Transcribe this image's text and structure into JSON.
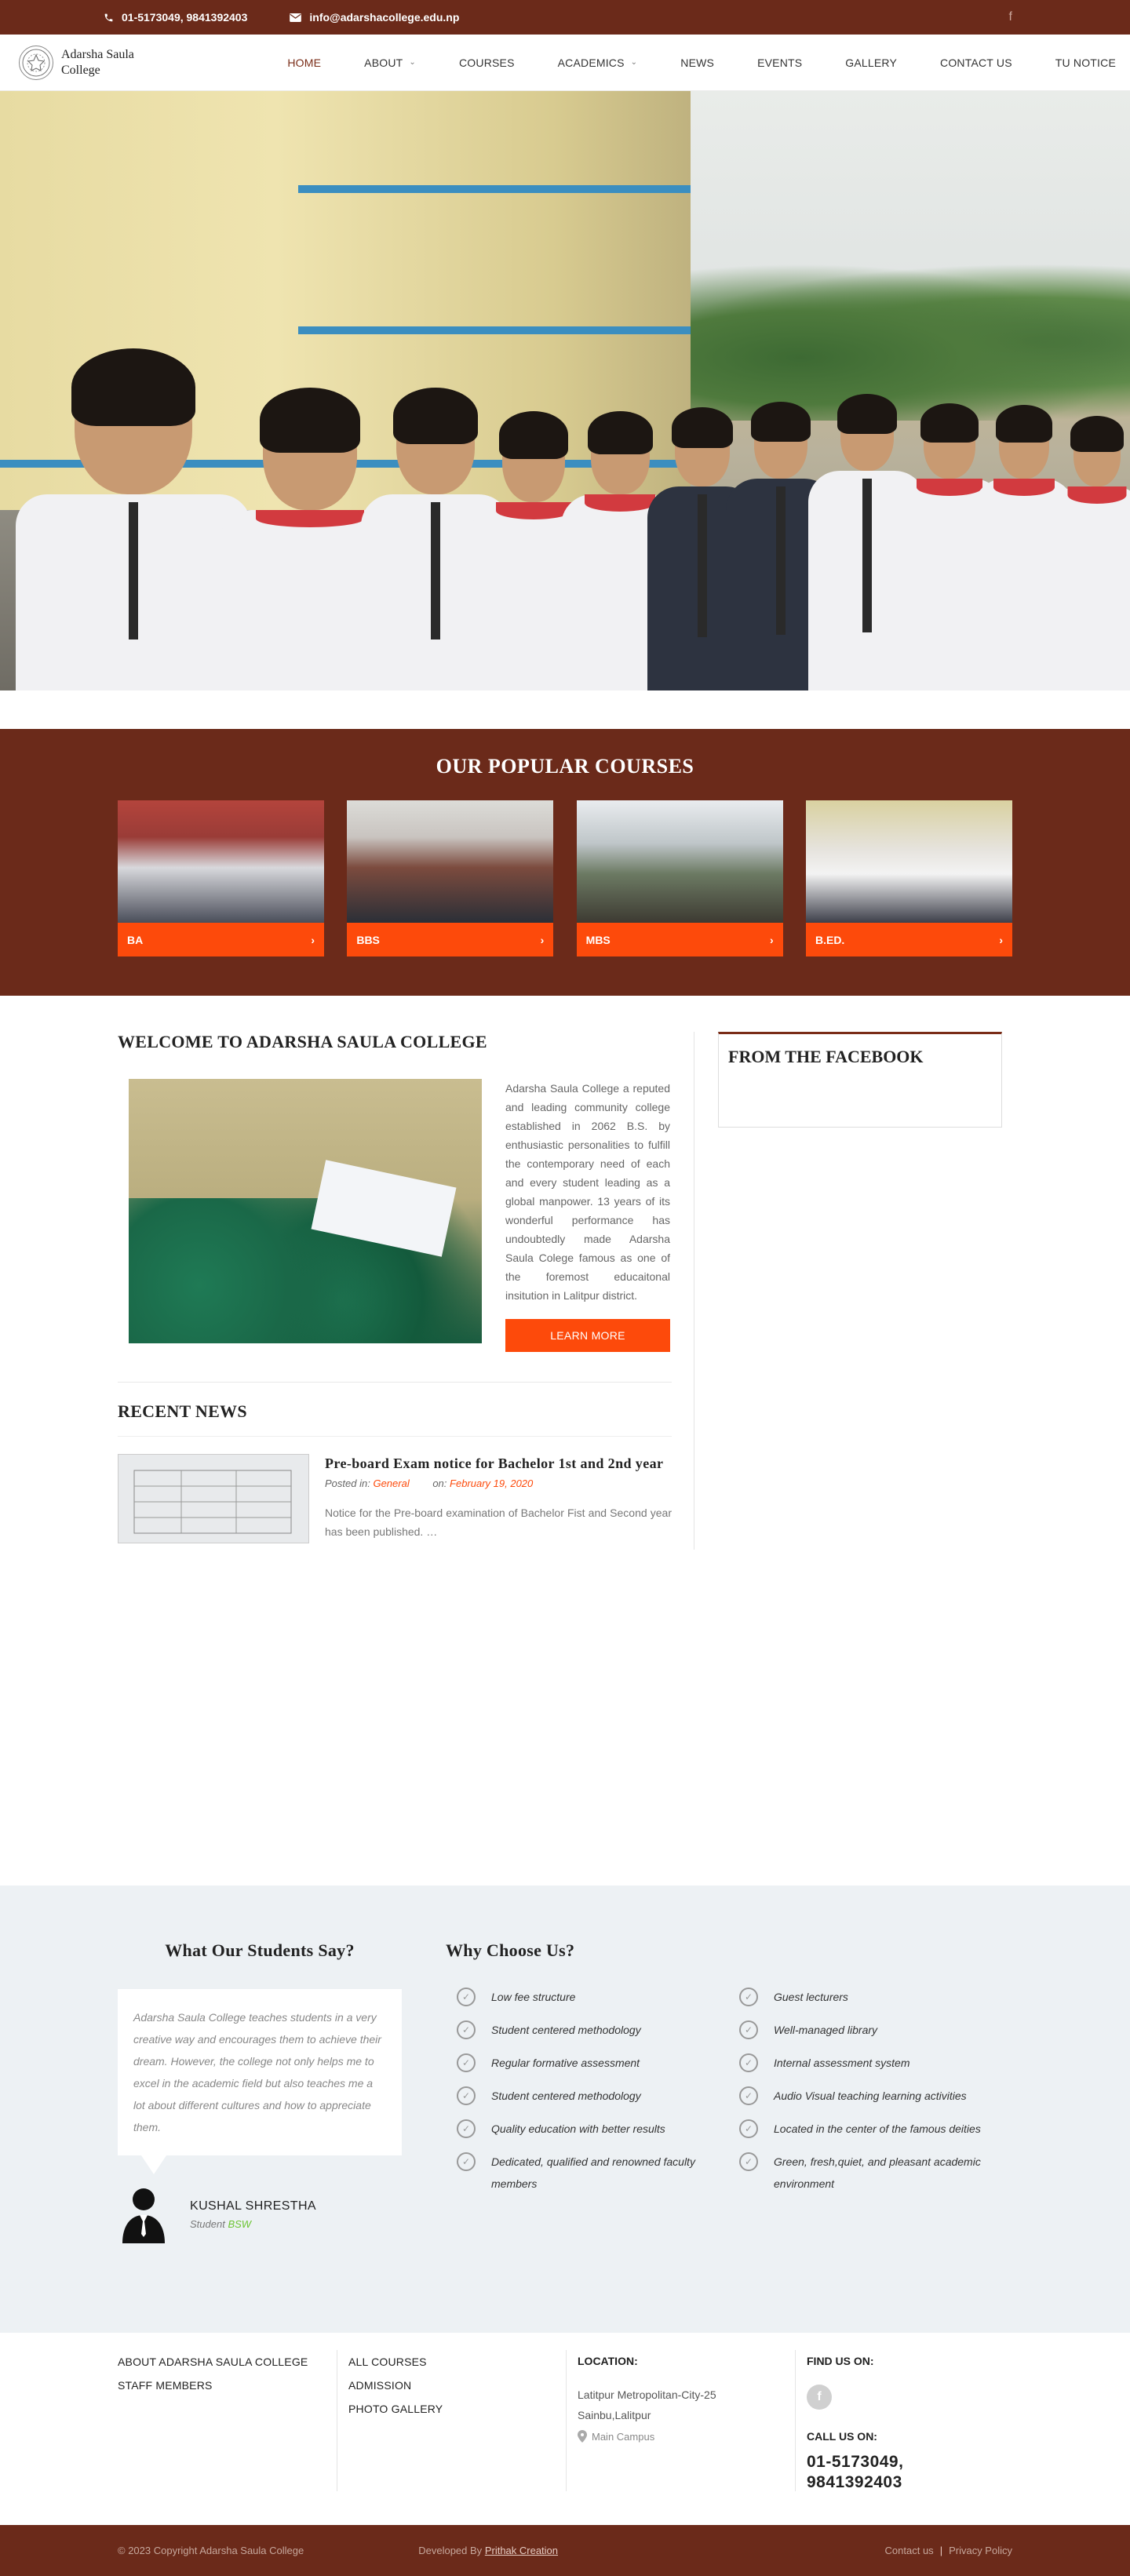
{
  "topbar": {
    "phone": "01-5173049, 9841392403",
    "email": "info@adarshacollege.edu.np",
    "social_icon": "facebook-icon"
  },
  "logo": {
    "line1": "Adarsha Saula",
    "line2": "College"
  },
  "menu": [
    {
      "label": "HOME",
      "active": true
    },
    {
      "label": "ABOUT",
      "dropdown": true
    },
    {
      "label": "COURSES"
    },
    {
      "label": "ACADEMICS",
      "dropdown": true
    },
    {
      "label": "NEWS"
    },
    {
      "label": "EVENTS"
    },
    {
      "label": "GALLERY"
    },
    {
      "label": "CONTACT US"
    },
    {
      "label": "TU NOTICE"
    }
  ],
  "courses": {
    "title": "OUR POPULAR COURSES",
    "items": [
      {
        "label": "BA"
      },
      {
        "label": "BBS"
      },
      {
        "label": "MBS"
      },
      {
        "label": "B.ED."
      }
    ]
  },
  "welcome": {
    "title": "WELCOME TO ADARSHA SAULA COLLEGE",
    "text": "Adarsha Saula College a reputed and leading community college established in 2062 B.S. by enthusiastic personalities to fulfill the contemporary need of each and every student leading as a global manpower. 13 years of its wonderful performance has undoubtedly made Adarsha Saula Colege famous as one of the foremost educaitonal insitution in Lalitpur district.",
    "button": "LEARN MORE"
  },
  "recent_news": {
    "title": "RECENT NEWS",
    "item": {
      "headline": "Pre-board Exam notice for Bachelor 1st and 2nd year",
      "posted_label": "Posted in:",
      "category": "General",
      "on_label": "on:",
      "date": "February 19, 2020",
      "excerpt": "Notice for the Pre-board examination of Bachelor Fist and Second year has been published. …"
    }
  },
  "facebook_box": {
    "title": "FROM THE FACEBOOK"
  },
  "testimonials": {
    "title": "What Our Students Say?",
    "quote": "Adarsha Saula College teaches students in a very creative way and encourages them to achieve their dream. However, the college not only helps me to excel in the academic field but also teaches me a lot about different cultures and how to appreciate them.",
    "name": "KUSHAL SHRESTHA",
    "role_prefix": "Student",
    "role_program": "BSW"
  },
  "why": {
    "title": "Why Choose Us?",
    "items": [
      "Low fee structure",
      "Guest lecturers",
      "Student centered methodology",
      "Well-managed library",
      "Regular formative assessment",
      "Internal assessment system",
      "Student centered methodology",
      "Audio Visual teaching learning activities",
      "Quality education with better results",
      "Located in the center of the famous deities",
      "Dedicated, qualified and renowned faculty members",
      "Green, fresh,quiet, and pleasant academic environment"
    ]
  },
  "footer": {
    "col1": [
      "ABOUT ADARSHA SAULA COLLEGE",
      "STAFF MEMBERS"
    ],
    "col2": [
      "ALL COURSES",
      "ADMISSION",
      "PHOTO GALLERY"
    ],
    "location_title": "LOCATION:",
    "address": "Latitpur Metropolitan-City-25 Sainbu,Lalitpur",
    "campus": "Main Campus",
    "find_us": "FIND US ON:",
    "call_us": "CALL US ON:",
    "phones": "01-5173049, 9841392403"
  },
  "copyright": {
    "text": "© 2023 Copyright Adarsha Saula College",
    "developed_prefix": "Developed By",
    "developer": "Prithak Creation",
    "link1": "Contact us",
    "link2": "Privacy Policy"
  },
  "colors": {
    "brand_brown": "#6b2a1a",
    "accent_orange": "#fd4a0b",
    "success_green": "#6bc431"
  }
}
